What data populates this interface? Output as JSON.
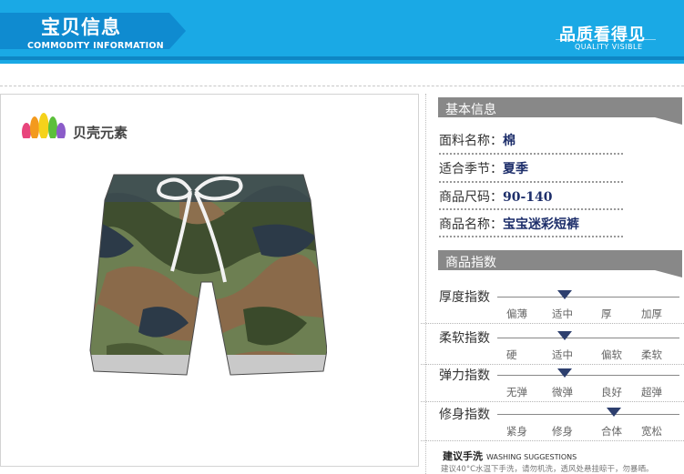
{
  "banner": {
    "title": "宝贝信息",
    "subtitle": "COMMODITY INFORMATION",
    "right_title": "品质看得见",
    "right_subtitle": "QUALITY VISIBLE",
    "color": "#1aa9e5"
  },
  "brand": {
    "name": "贝壳元素",
    "logo_icon": "shell-rainbow-logo"
  },
  "product_image": {
    "description_icon": "camouflage-shorts-image"
  },
  "basic_info": {
    "header": "基本信息",
    "rows": [
      {
        "label": "面料名称：",
        "value": "棉"
      },
      {
        "label": "适合季节：",
        "value": "夏季"
      },
      {
        "label": "商品尺码：",
        "value": "90-140"
      },
      {
        "label": "商品名称：",
        "value": "宝宝迷彩短裤"
      }
    ]
  },
  "indices": {
    "header": "商品指数",
    "items": [
      {
        "label": "厚度指数",
        "options": [
          "偏薄",
          "适中",
          "厚",
          "加厚"
        ],
        "selected": 1
      },
      {
        "label": "柔软指数",
        "options": [
          "硬",
          "适中",
          "偏软",
          "柔软"
        ],
        "selected": 1
      },
      {
        "label": "弹力指数",
        "options": [
          "无弹",
          "微弹",
          "良好",
          "超弹"
        ],
        "selected": 1
      },
      {
        "label": "修身指数",
        "options": [
          "紧身",
          "修身",
          "合体",
          "宽松"
        ],
        "selected": 2
      }
    ],
    "marker_color": "#2d3f6e"
  },
  "washing": {
    "title": "建议手洗",
    "title_en": "WASHING SUGGESTIONS",
    "text": "建议40°C水温下手洗，请勿机洗，透风处悬挂晾干，勿暴晒。"
  }
}
